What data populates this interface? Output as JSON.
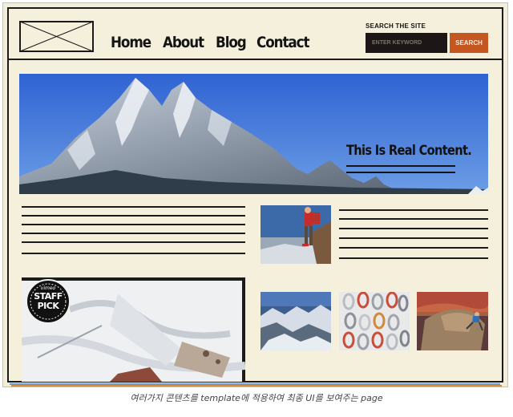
{
  "header": {
    "logo": "logo placeholder",
    "nav": [
      "Home",
      "About",
      "Blog",
      "Contact"
    ],
    "search": {
      "label": "SEARCH THE SITE",
      "placeholder": "ENTER KEYWORD",
      "button": "SEARCH"
    }
  },
  "hero": {
    "title": "This Is Real Content."
  },
  "badge": {
    "brand": "vimeo",
    "line1": "STAFF",
    "line2": "PICK"
  },
  "caption": "여러가지 콘텐츠를 template에 적용하여 최종 UI를 보여주는 page",
  "colors": {
    "accent": "#c5561f",
    "paper": "#f2eedb",
    "ink": "#1b1b1b",
    "input": "#1c1616",
    "hero_sky": "#3f72d8"
  }
}
